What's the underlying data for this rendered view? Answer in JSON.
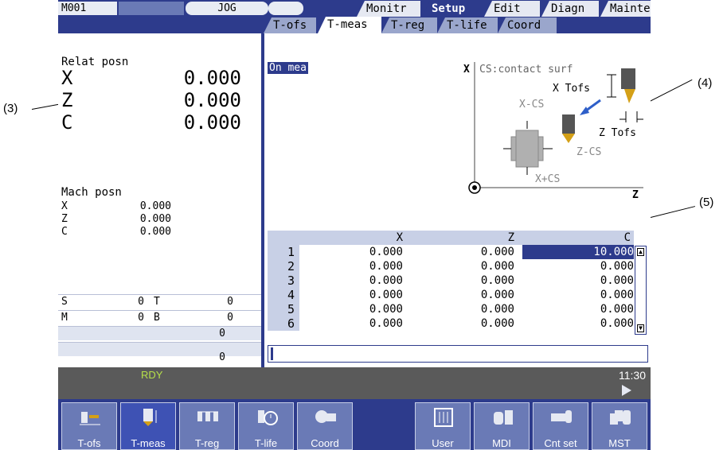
{
  "callouts": [
    "(3)",
    "(4)",
    "(5)"
  ],
  "header": {
    "program_id": "M001",
    "mode": "JOG",
    "main_tabs": [
      "Monitr",
      "Setup",
      "Edit",
      "Diagn",
      "Mainte"
    ],
    "active_main_tab": "Setup"
  },
  "sub_tabs": [
    "T-ofs",
    "T-meas",
    "T-reg",
    "T-life",
    "Coord"
  ],
  "active_sub_tab": "T-meas",
  "relat_posn": {
    "label": "Relat posn",
    "axes": [
      {
        "axis": "X",
        "value": "0.000"
      },
      {
        "axis": "Z",
        "value": "0.000"
      },
      {
        "axis": "C",
        "value": "0.000"
      }
    ]
  },
  "mach_posn": {
    "label": "Mach posn",
    "axes": [
      {
        "axis": "X",
        "value": "0.000"
      },
      {
        "axis": "Z",
        "value": "0.000"
      },
      {
        "axis": "C",
        "value": "0.000"
      }
    ]
  },
  "modal": {
    "s_label": "S",
    "s_value": "0",
    "t_label": "T",
    "t_value": "0",
    "m_label": "M",
    "m_value": "0",
    "b_label": "B",
    "b_value": "0",
    "extra1": "0",
    "extra2": "0"
  },
  "measure_status": "On mea",
  "diagram": {
    "x_axis": "X",
    "z_axis": "Z",
    "legend": "CS:contact surf",
    "x_tofs": "X Tofs",
    "z_tofs": "Z Tofs",
    "x_minus_cs": "X-CS",
    "z_minus_cs": "Z-CS",
    "x_plus_cs": "X+CS"
  },
  "table": {
    "columns": [
      "X",
      "Z",
      "C"
    ],
    "rows": [
      {
        "n": "1",
        "x": "0.000",
        "z": "0.000",
        "c": "10.000"
      },
      {
        "n": "2",
        "x": "0.000",
        "z": "0.000",
        "c": "0.000"
      },
      {
        "n": "3",
        "x": "0.000",
        "z": "0.000",
        "c": "0.000"
      },
      {
        "n": "4",
        "x": "0.000",
        "z": "0.000",
        "c": "0.000"
      },
      {
        "n": "5",
        "x": "0.000",
        "z": "0.000",
        "c": "0.000"
      },
      {
        "n": "6",
        "x": "0.000",
        "z": "0.000",
        "c": "0.000"
      }
    ]
  },
  "status": {
    "state": "RDY",
    "time": "11:30"
  },
  "softkeys": [
    {
      "label": "T-ofs",
      "icon": "tool-offset-icon"
    },
    {
      "label": "T-meas",
      "icon": "tool-measure-icon"
    },
    {
      "label": "T-reg",
      "icon": "tool-register-icon"
    },
    {
      "label": "T-life",
      "icon": "tool-life-icon"
    },
    {
      "label": "Coord",
      "icon": "coordinate-icon"
    },
    {
      "label": "",
      "icon": ""
    },
    {
      "label": "User",
      "icon": "user-parameter-icon"
    },
    {
      "label": "MDI",
      "icon": "hand-mdi-icon"
    },
    {
      "label": "Cnt set",
      "icon": "counter-set-icon"
    },
    {
      "label": "MST",
      "icon": "mst-icon"
    }
  ],
  "colors": {
    "frame": "#2d3b8c",
    "highlight": "#2d3b8c",
    "ready": "#b6e04a"
  }
}
